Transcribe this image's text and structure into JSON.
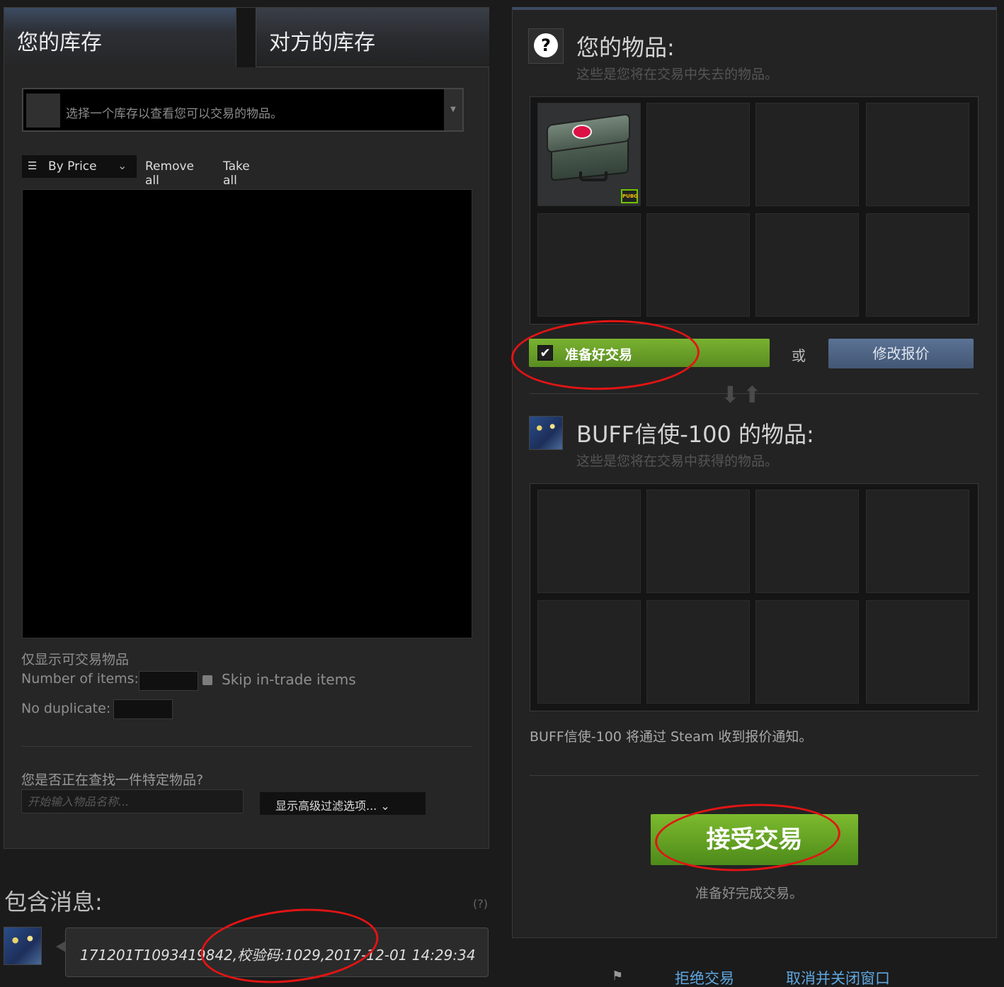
{
  "tabs": {
    "mine": "您的库存",
    "theirs": "对方的库存"
  },
  "inventory_select": {
    "text": "选择一个库存以查看您可以交易的物品。"
  },
  "toolbar": {
    "sort_label": "By Price",
    "remove_all": "Remove all",
    "take_all": "Take all"
  },
  "filters": {
    "only_tradable": "仅显示可交易物品",
    "number_of_items": "Number of items:",
    "skip_in_trade": "Skip in-trade items",
    "no_duplicate": "No duplicate:",
    "find_question": "您是否正在查找一件特定物品?",
    "search_placeholder": "开始输入物品名称...",
    "advanced_filter": "显示高级过滤选项..."
  },
  "message": {
    "title": "包含消息:",
    "help": "(?)",
    "text": "171201T1093419842,校验码:1029,2017-12-01 14:29:34"
  },
  "my_items": {
    "title": "您的物品:",
    "subtitle": "这些是您将在交易中失去的物品。",
    "badge": "PUBG"
  },
  "ready_button": "准备好交易",
  "or_text": "或",
  "change_offer": "修改报价",
  "their_items": {
    "title": "BUFF信使-100 的物品:",
    "subtitle": "这些是您将在交易中获得的物品。"
  },
  "notify_text": "BUFF信使-100 将通过 Steam 收到报价通知。",
  "accept_button": "接受交易",
  "ready_status": "准备好完成交易。",
  "footer": {
    "decline": "拒绝交易",
    "cancel_close": "取消并关闭窗口"
  },
  "colors": {
    "accent_green": "#6a9f27",
    "link_blue": "#5fa7e0",
    "annotation_red": "#e21414"
  },
  "icons": [
    "question-icon",
    "sort-icon",
    "chevron-down-icon",
    "checkbox-icon",
    "swap-arrows-icon",
    "flag-icon"
  ]
}
